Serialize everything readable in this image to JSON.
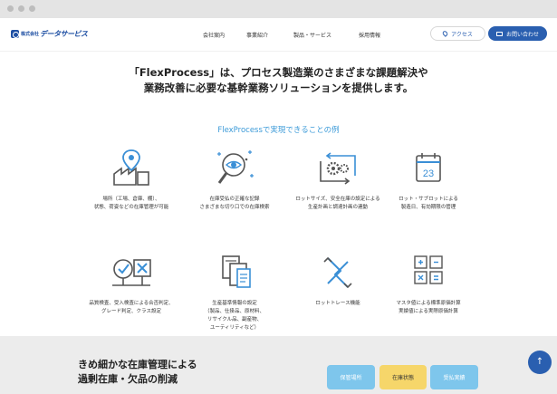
{
  "header": {
    "logo_small": "株式会社",
    "logo_main": "データサービス",
    "nav": [
      "会社案内",
      "事業紹介",
      "製品・サービス",
      "採用情報"
    ],
    "access_label": "アクセス",
    "contact_label": "お問い合わせ"
  },
  "hero": {
    "line1": "「FlexProcess」は、プロセス製造業のさまざまな課題解決や",
    "line2": "業務改善に必要な基幹業務ソリューションを提供します。"
  },
  "examples": {
    "title": "FlexProcessで実現できることの例",
    "items": [
      {
        "text": "場所（工場、倉庫、棚）、\n状態、荷姿などの在庫管理が可能"
      },
      {
        "text": "在庫受払の正確な記録\nさまざまな切り口での在庫検索"
      },
      {
        "text": "ロットサイズ、安全在庫の設定による\n生産計画と調達計画の連動"
      },
      {
        "text": "ロット・サブロットによる\n製造日、有効期限の管理",
        "calendar_number": "23"
      },
      {
        "text": "品質検査、受入検査による合否判定、\nグレード判定、クラス設定"
      },
      {
        "text": "生産基準情報の設定\n（製品、仕掛品、原材料、\nリサイクル品、副産物、\nユーティリティなど）"
      },
      {
        "text": "ロットトレース機能"
      },
      {
        "text": "マスタ値による標準原価計算\n実績値による実際原価計算"
      }
    ]
  },
  "band": {
    "title": "きめ細かな在庫管理による\n過剰在庫・欠品の削減",
    "tags": [
      "保管場所",
      "在庫状態",
      "受払実績"
    ]
  },
  "colors": {
    "primary": "#2a5fb0",
    "accent": "#3b9ad8",
    "icon_blue": "#3a8fd6",
    "tag_yellow": "#f6d66a"
  }
}
